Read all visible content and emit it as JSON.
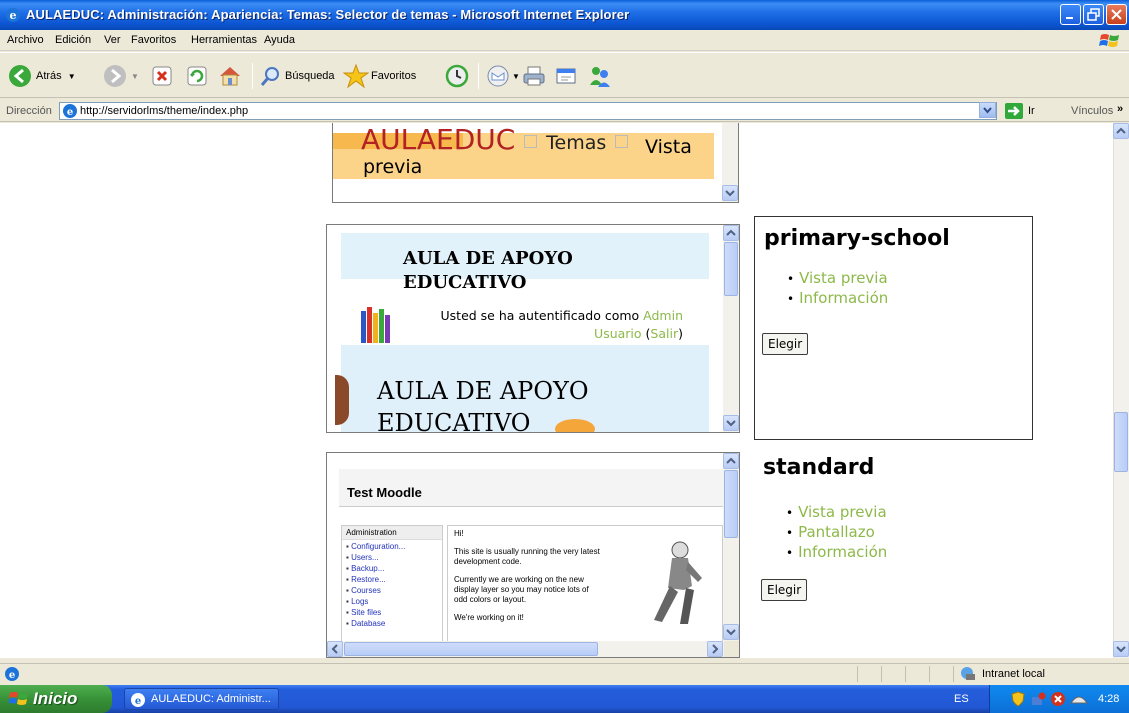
{
  "window": {
    "title": "AULAEDUC: Administración: Apariencia: Temas: Selector de temas - Microsoft Internet Explorer"
  },
  "menu": [
    "Archivo",
    "Edición",
    "Ver",
    "Favoritos",
    "Herramientas",
    "Ayuda"
  ],
  "toolbar": {
    "back_label": "Atrás",
    "search_label": "Búsqueda",
    "favorites_label": "Favoritos"
  },
  "address": {
    "label": "Dirección",
    "url": "http://servidorlms/theme/index.php",
    "go_label": "Ir",
    "links_label": "Vínculos"
  },
  "preview_top": {
    "site_name": "AULAEDUC",
    "crumb1": "Temas",
    "crumb2": "Vista previa"
  },
  "preview_primary": {
    "header_title": "AULA DE APOYO EDUCATIVO",
    "logged_text": "Usted se ha autentificado como",
    "user_link": "Admin Usuario",
    "logout_link": "Salir",
    "banner_text": "AULA DE APOYO EDUCATIVO"
  },
  "preview_standard": {
    "site_title": "Test Moodle",
    "admin_block_title": "Administration",
    "admin_items": [
      "Configuration...",
      "Users...",
      "Backup...",
      "Restore...",
      "Courses",
      "Logs",
      "Site files",
      "Database"
    ],
    "main_greeting": "Hi!",
    "main_p1": "This site is usually running the very latest development code.",
    "main_p2": "Currently we are working on the new display layer so you may notice lots of odd colors or layout.",
    "main_p3": "We're working on it!"
  },
  "themes": [
    {
      "name": "primary-school",
      "links": [
        "Vista previa",
        "Información"
      ],
      "button": "Elegir"
    },
    {
      "name": "standard",
      "links": [
        "Vista previa",
        "Pantallazo",
        "Información"
      ],
      "button": "Elegir"
    }
  ],
  "statusbar": {
    "zone": "Intranet local"
  },
  "taskbar": {
    "start_label": "Inicio",
    "task_label": "AULAEDUC: Administr...",
    "lang": "ES",
    "clock": "4:28"
  }
}
